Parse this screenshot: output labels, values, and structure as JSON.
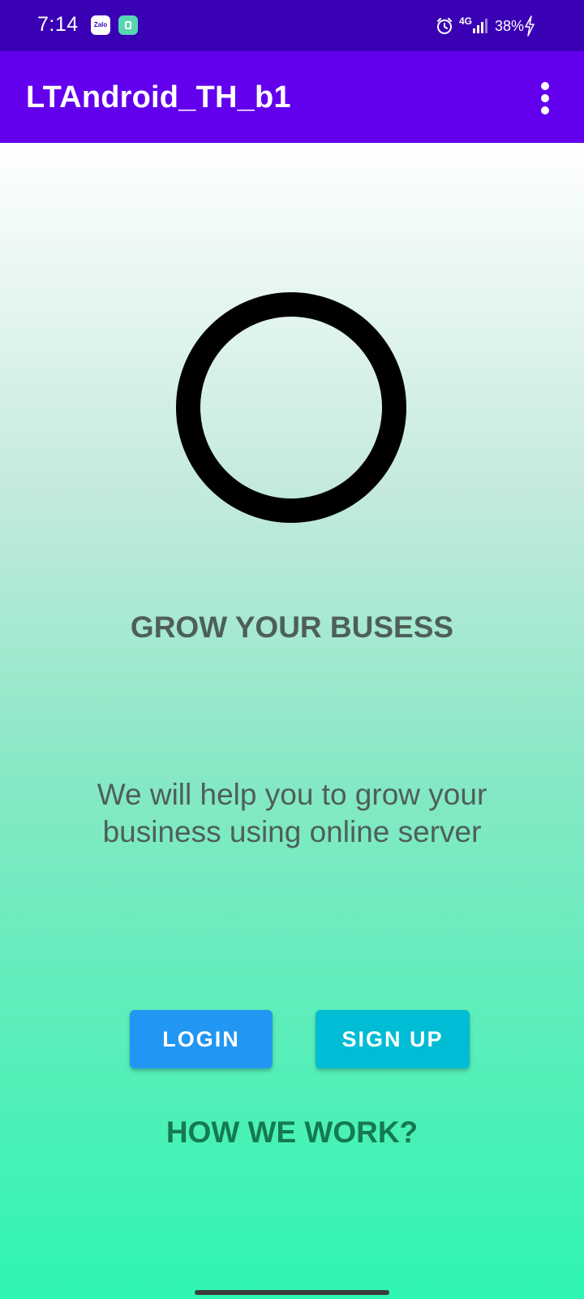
{
  "status_bar": {
    "time": "7:14",
    "notification_icons": [
      "zalo-icon",
      "store-icon"
    ],
    "zalo_text": "Zalo",
    "network": "4G",
    "battery": "38%",
    "charging": true
  },
  "app_bar": {
    "title": "LTAndroid_TH_b1",
    "menu_icon": "more-vert-icon"
  },
  "hero": {
    "headline": "GROW YOUR BUSESS",
    "tagline": "We will help you to grow your business using online server"
  },
  "actions": {
    "login_label": "LOGIN",
    "signup_label": "SIGN UP"
  },
  "footer": {
    "how_label": "HOW WE WORK?"
  },
  "colors": {
    "status_bar": "#3a00b4",
    "app_bar": "#6200ee",
    "login_button": "#2196f3",
    "signup_button": "#00bcd4",
    "heading_text": "#4e5f58",
    "link_text": "#157a4f",
    "gradient_top": "#ffffff",
    "gradient_bottom": "#2ef5b0"
  }
}
